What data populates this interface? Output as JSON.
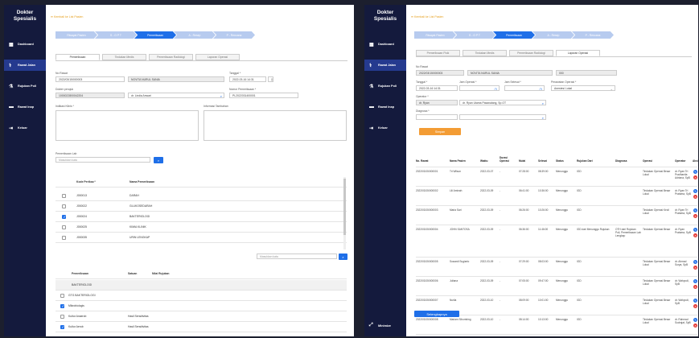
{
  "app": {
    "title_line1": "Dokter",
    "title_line2": "Spesialis"
  },
  "sidebar": {
    "items": [
      {
        "label": "Dashboard",
        "icon": "dashboard-icon"
      },
      {
        "label": "Rawat Jalan",
        "icon": "stethoscope-icon",
        "active": true
      },
      {
        "label": "Rujukan Poli",
        "icon": "referral-icon"
      },
      {
        "label": "Rawat Inap",
        "icon": "bed-icon"
      },
      {
        "label": "Keluar",
        "icon": "logout-icon"
      }
    ],
    "bottom_label": "Minimize"
  },
  "left": {
    "header_link": "Kembali ke List Pasien",
    "steps": [
      "Riwayat Pasien",
      "S - O P T",
      "Pemeriksaan",
      "A - Resep",
      "P - Rencana"
    ],
    "tabs": [
      "Pemeriksaan",
      "Tindakan Medis",
      "Pemeriksaan Radiologi",
      "Laporan Operasi"
    ],
    "form": {
      "no_rawat_label": "No Rawat",
      "no_rawat_value": "2022/03/15/000003",
      "nama_value": "NOVITA NURUL SANIA",
      "tanggal_label": "Tanggal *",
      "tanggal_value": "2022-03-16  14:31",
      "dokter_label": "Dokter perujuk",
      "dokter_value": "1000022800042204",
      "poli_value": "dr. Lindia Anwari",
      "nomor_label": "Nomor Pemeriksaan *",
      "nomor_value": "PL2022031400001",
      "indikasi_label": "Indikasi Klinis *",
      "informasi_label": "Informasi Tambahan",
      "cari_label": "Pemeriksaan Lab",
      "cari_placeholder": "Masukkan kata"
    },
    "lab_table": {
      "headers": [
        "Kode Periksa *",
        "Nama Pemeriksaan"
      ],
      "rows": [
        {
          "code": "J000013",
          "name": "DARAH",
          "checked": false
        },
        {
          "code": "J000022",
          "name": "GLUKOSEDARAH",
          "checked": false
        },
        {
          "code": "J000024",
          "name": "BAKTERIOLOGI",
          "checked": true
        },
        {
          "code": "J000025",
          "name": "KIMIA KLINIK",
          "checked": false
        },
        {
          "code": "J000035",
          "name": "URIN LENGKAP",
          "checked": false
        }
      ]
    },
    "search2_placeholder": "Masukkan kata",
    "result_table": {
      "headers": [
        "Pemeriksaan",
        "Satuan",
        "Nilai Rujukan"
      ],
      "group": "BAKTERIOLOGI",
      "rows": [
        {
          "name": "GTG BAKTERIOLOGI",
          "satuan": "",
          "nilai": "",
          "checked": false
        },
        {
          "name": "Mikrobiologis",
          "satuan": "",
          "nilai": "",
          "checked": true
        },
        {
          "name": "Kultur Anaerob",
          "satuan": "",
          "nilai": "Hasil Sensitivitas",
          "checked": false
        },
        {
          "name": "Kultur Aerob",
          "satuan": "",
          "nilai": "Hasil Sensitivitas",
          "checked": true
        }
      ]
    }
  },
  "right": {
    "header_link": "Kembali ke List Pasien",
    "steps": [
      "Riwayat Pasien",
      "S - O P T",
      "Pemeriksaan",
      "A - Resep",
      "P - Rencana"
    ],
    "tabs": [
      "Pemeriksaan Fisik",
      "Tindakan Medis",
      "Pemeriksaan Radiologi",
      "Laporan Operasi"
    ],
    "form": {
      "no_rawat_label": "No Rawat",
      "no_rawat_value": "2022/03/15/000003",
      "nama_value": "NOVITA NURUL SANIA",
      "rm_value": "000",
      "tgl_label": "Tanggal *",
      "tgl_value": "2022-03-16 14:31",
      "jam_label": "Jam Operasi *",
      "selesai_label": "Jam Selesai *",
      "perawatan_label": "Perawatan Operasi *",
      "perawatan_value": "Anestesi Lokal",
      "operator_label": "Operator *",
      "operator_value": "dr. Ryan",
      "operator_detail": "dr. Ryan Utama Pasanalang, Sp.OT",
      "diagnosa_label": "Diagnosa *",
      "simpan": "Simpan"
    },
    "table": {
      "headers": [
        "No. Rawat",
        "Nama Pasien",
        "Waktu",
        "Durasi Operasi",
        "Mulai",
        "Selesai",
        "Status",
        "Rujukan Dari",
        "Diagnosa",
        "Operasi",
        "Operator",
        "Aksi"
      ],
      "rows": [
        [
          "2022/03/15/000001",
          "Tri Wilson",
          "2022-03-07",
          "-",
          "07:28:00",
          "08:39:00",
          "Menunggu",
          "IGD",
          "",
          "Tindakan Operasi Besar Lokal",
          "dr. Ryan Tri Pradhanita Adriana, SpB"
        ],
        [
          "2022/03/15/000002",
          "Lili Aminah",
          "2022-03-09",
          "-",
          "06:41:00",
          "10:36:00",
          "Menunggu",
          "IGD",
          "",
          "Tindakan Operasi Besar Lokal",
          "dr. Ryan Tri Pratama, SpB"
        ],
        [
          "2022/03/15/000003",
          "Maria Sari",
          "2022-03-09",
          "-",
          "06:26:00",
          "10:26:00",
          "Menunggu",
          "IGD",
          "",
          "Tindakan Operasi Kecil Lokal",
          "dr. Ryan Tri Pratama, SpB"
        ],
        [
          "2022/03/15/000004",
          "JOHN SANTOSA",
          "2022-03-09",
          "-",
          "06:36:00",
          "11:46:00",
          "Menunggu",
          "IGD dari Menunggu Rujukan",
          "OTH dari Rujukan Poli, Pemeriksaan Lab Lengkap",
          "Tindakan Operasi Besar",
          "dr. Ryan Pratama, SpB"
        ],
        [
          "2022/03/15/000005",
          "Suwardi Sugiarto",
          "2022-03-09",
          "-",
          "07:29:00",
          "08:03:00",
          "Menunggu",
          "IGD",
          "",
          "Tindakan Operasi Besar Lokal",
          "dr. Ahmad Surya, SpB"
        ],
        [
          "2022/03/15/000006",
          "Juliana",
          "2022-03-09",
          "-",
          "07:05:00",
          "09:47:00",
          "Menunggu",
          "IGD",
          "",
          "Tindakan Operasi Besar Lokal",
          "dr. Wahyudi, SpB"
        ],
        [
          "2022/03/15/000007",
          "Nurlia",
          "2022-03-10",
          "-",
          "08:09:00",
          "10:01:00",
          "Menunggu",
          "IGD",
          "",
          "Tindakan Operasi Besar Lokal",
          "dr. Wahyudi, SpB"
        ],
        [
          "2022/03/15/000008",
          "Mariam Sihombing",
          "2022-03-10",
          "-",
          "08:14:00",
          "10:13:00",
          "Menunggu",
          "IGD",
          "",
          "Tindakan Operasi Besar Lokal",
          "dr. Rahmad Sudrajat, SpB"
        ]
      ]
    },
    "bottom_button": "Selengkapnya"
  }
}
